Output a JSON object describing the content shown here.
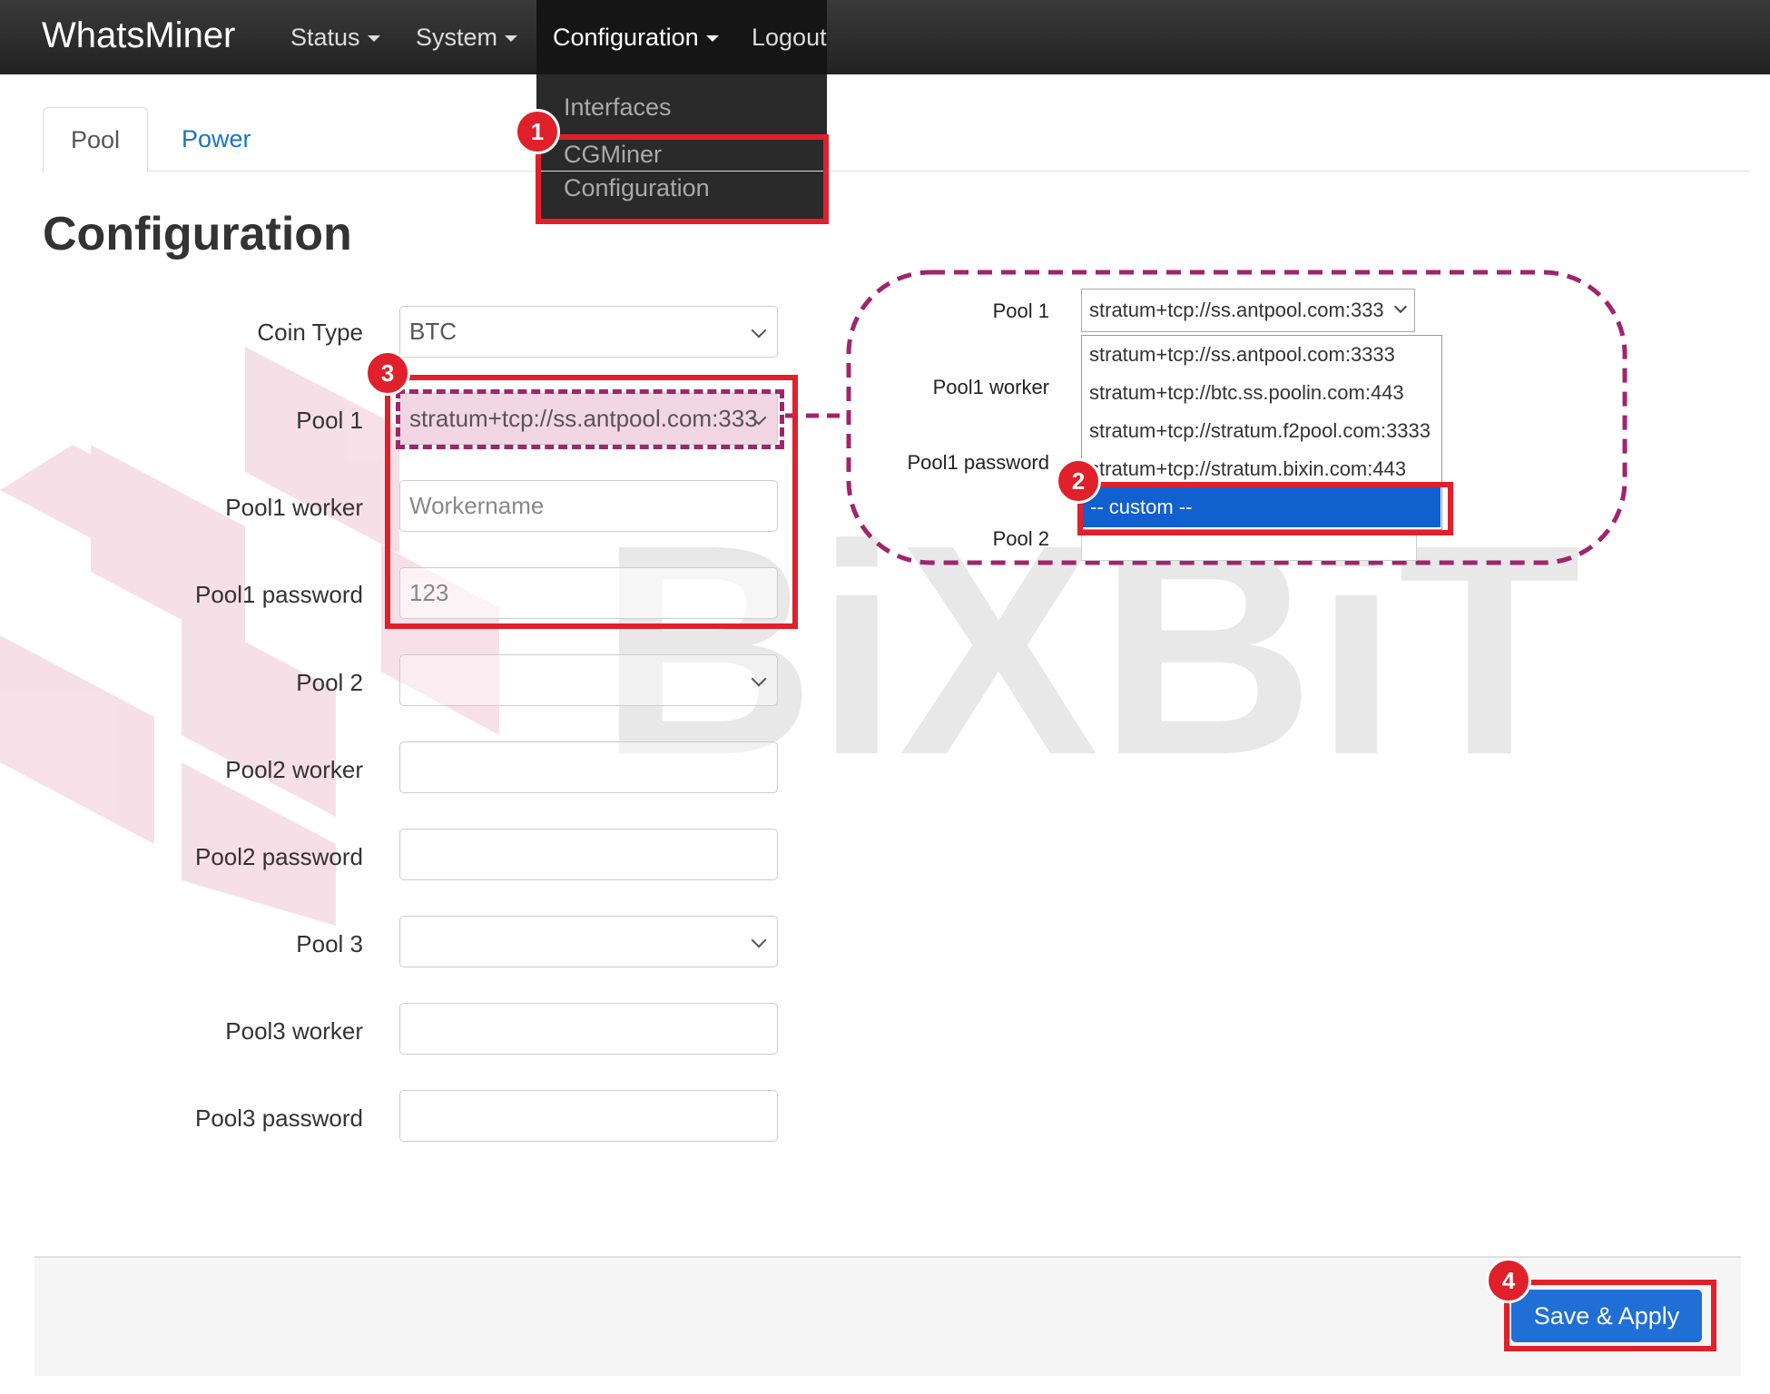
{
  "navbar": {
    "brand": "WhatsMiner",
    "items": [
      {
        "label": "Status"
      },
      {
        "label": "System"
      },
      {
        "label": "Configuration"
      },
      {
        "label": "Logout"
      }
    ],
    "dropdown": [
      "Interfaces",
      "CGMiner",
      "Configuration"
    ]
  },
  "tabs": [
    {
      "label": "Pool"
    },
    {
      "label": "Power"
    }
  ],
  "page_title": "Configuration",
  "watermark": "BiXBiT",
  "form": {
    "coin_type_label": "Coin Type",
    "coin_type_value": "BTC",
    "pool1_label": "Pool 1",
    "pool1_value": "stratum+tcp://ss.antpool.com:333",
    "pool1_worker_label": "Pool1 worker",
    "pool1_worker_placeholder": "Workername",
    "pool1_password_label": "Pool1 password",
    "pool1_password_value": "123",
    "pool2_label": "Pool 2",
    "pool2_worker_label": "Pool2 worker",
    "pool2_password_label": "Pool2 password",
    "pool3_label": "Pool 3",
    "pool3_worker_label": "Pool3 worker",
    "pool3_password_label": "Pool3 password"
  },
  "zoom": {
    "pool1_label": "Pool 1",
    "pool1_value": "stratum+tcp://ss.antpool.com:333",
    "pool1_worker_label": "Pool1 worker",
    "pool1_password_label": "Pool1 password",
    "pool2_label": "Pool 2",
    "options": [
      "stratum+tcp://ss.antpool.com:3333",
      "stratum+tcp://btc.ss.poolin.com:443",
      "stratum+tcp://stratum.f2pool.com:3333",
      "stratum+tcp://stratum.bixin.com:443"
    ],
    "custom_option": "-- custom --"
  },
  "footer": {
    "save_label": "Save & Apply"
  },
  "annotations": {
    "step1": "1",
    "step2": "2",
    "step3": "3",
    "step4": "4"
  },
  "colors": {
    "annotation_red": "#e0202a",
    "dashed_purple": "#a0246e",
    "primary_blue": "#1f6fd6"
  }
}
